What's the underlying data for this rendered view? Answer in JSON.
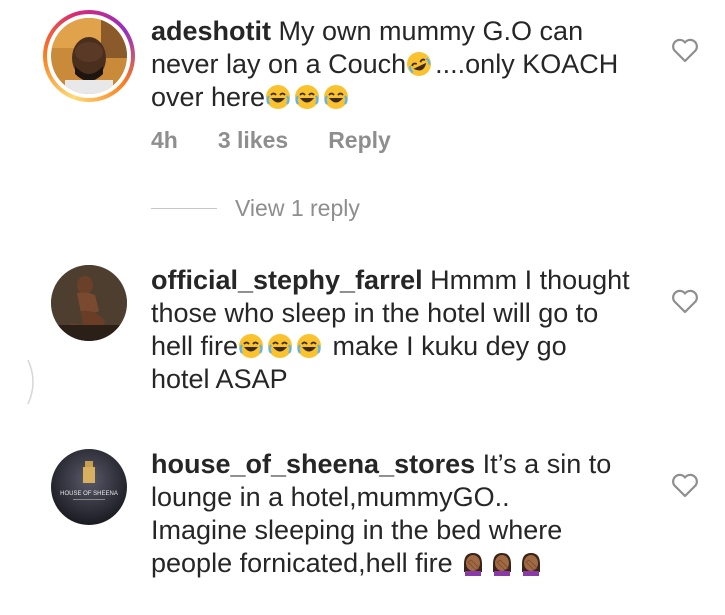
{
  "comments": [
    {
      "username": "adeshotit",
      "text_line1": "My own mummy G.O can",
      "text_line2a": "never lay on a Couch",
      "text_line2b": "....only KOACH",
      "text_line3": "over here",
      "time": "4h",
      "likes": "3 likes",
      "reply_label": "Reply",
      "view_replies": "View 1 reply"
    },
    {
      "username": "official_stephy_farrel",
      "text_line1": "Hmmm I thought",
      "text_line2": "those who sleep in the hotel will go to",
      "text_line3a": "hell fire",
      "text_line3b": " make I kuku dey go",
      "text_line4": "hotel ASAP"
    },
    {
      "username": "house_of_sheena_stores",
      "text_line1": "It’s a sin to",
      "text_line2": "lounge in a hotel,mummyGO..",
      "text_line3": "Imagine sleeping in the bed where",
      "text_line4": "people fornicated,hell fire",
      "avatar_text": "HOUSE OF SHEENA"
    }
  ],
  "colors": {
    "text": "#262626",
    "meta": "#8e8e8e",
    "heart": "#8e8e8e"
  },
  "icons": {
    "heart": "heart-outline-icon",
    "laughing": "rolling-on-floor-laughing-emoji",
    "tears_of_joy": "face-with-tears-of-joy-emoji",
    "facepalm": "woman-facepalming-emoji"
  }
}
